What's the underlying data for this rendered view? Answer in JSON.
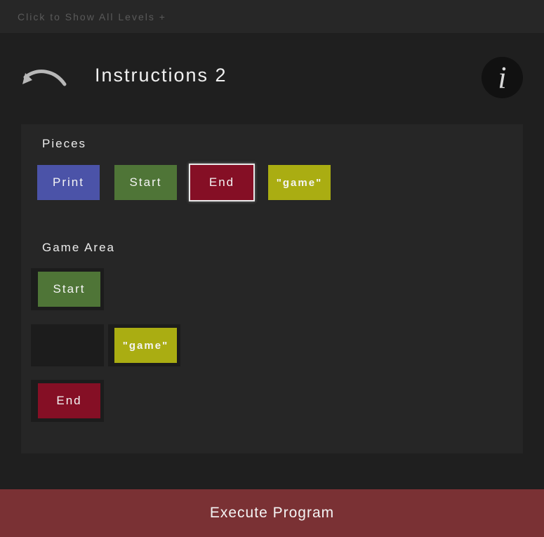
{
  "top_bar": {
    "show_levels_label": "Click to Show All Levels +"
  },
  "header": {
    "title": "Instructions 2",
    "info_icon_glyph": "i"
  },
  "pieces": {
    "label": "Pieces",
    "items": [
      {
        "label": "Print",
        "color": "#4b53a8"
      },
      {
        "label": "Start",
        "color": "#4f7537"
      },
      {
        "label": "End",
        "color": "#850f25",
        "selected": true
      },
      {
        "label": "\"game\"",
        "color": "#aaad12"
      }
    ]
  },
  "game_area": {
    "label": "Game Area",
    "rows": [
      {
        "slots": [
          {
            "piece": "Start",
            "color": "#4f7537"
          }
        ]
      },
      {
        "slots": [
          {
            "piece": null
          },
          {
            "piece": "\"game\"",
            "color": "#aaad12"
          }
        ]
      },
      {
        "slots": [
          {
            "piece": "End",
            "color": "#850f25"
          }
        ]
      }
    ]
  },
  "footer": {
    "execute_label": "Execute Program",
    "color": "#7a3134"
  }
}
